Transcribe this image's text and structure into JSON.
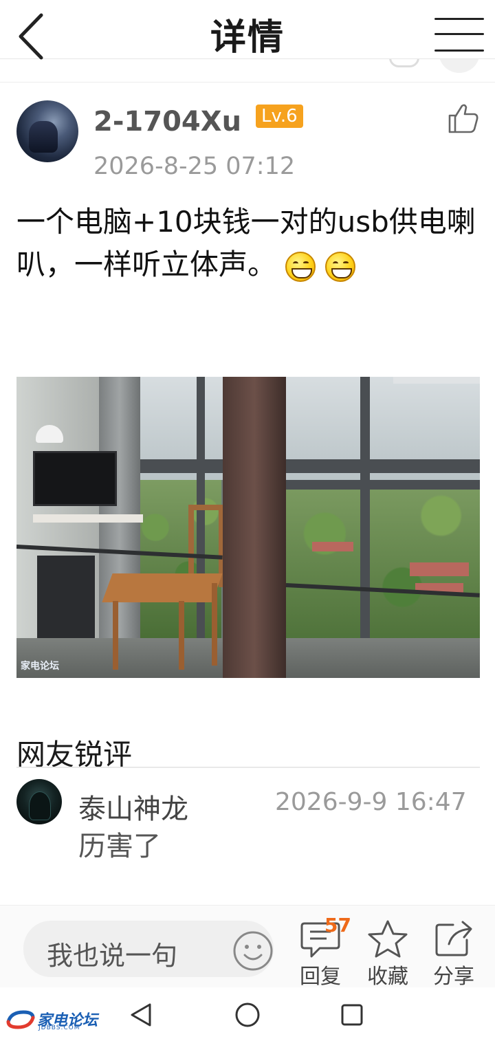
{
  "header": {
    "title": "详情"
  },
  "post": {
    "username": "2-1704Xu",
    "level": "Lv.6",
    "time": "2026-8-25 07:12",
    "text": "一个电脑+10块钱一对的usb供电喇叭，一样听立体声。",
    "emoji": "grin-emoji",
    "image_watermark": "家电论坛"
  },
  "comments": {
    "title": "网友锐评",
    "items": [
      {
        "user": "泰山神龙",
        "time": "2026-9-9 16:47",
        "text": "历害了"
      }
    ]
  },
  "bottom_bar": {
    "placeholder": "我也说一句",
    "reply_label": "回复",
    "reply_count": "57",
    "favorite_label": "收藏",
    "share_label": "分享"
  },
  "watermark": {
    "name": "家电论坛",
    "domain": "JDBBS.COM"
  },
  "colors": {
    "level_badge": "#f6a21e",
    "reply_count": "#ee6a1a",
    "logo": "#1a5fb4"
  }
}
